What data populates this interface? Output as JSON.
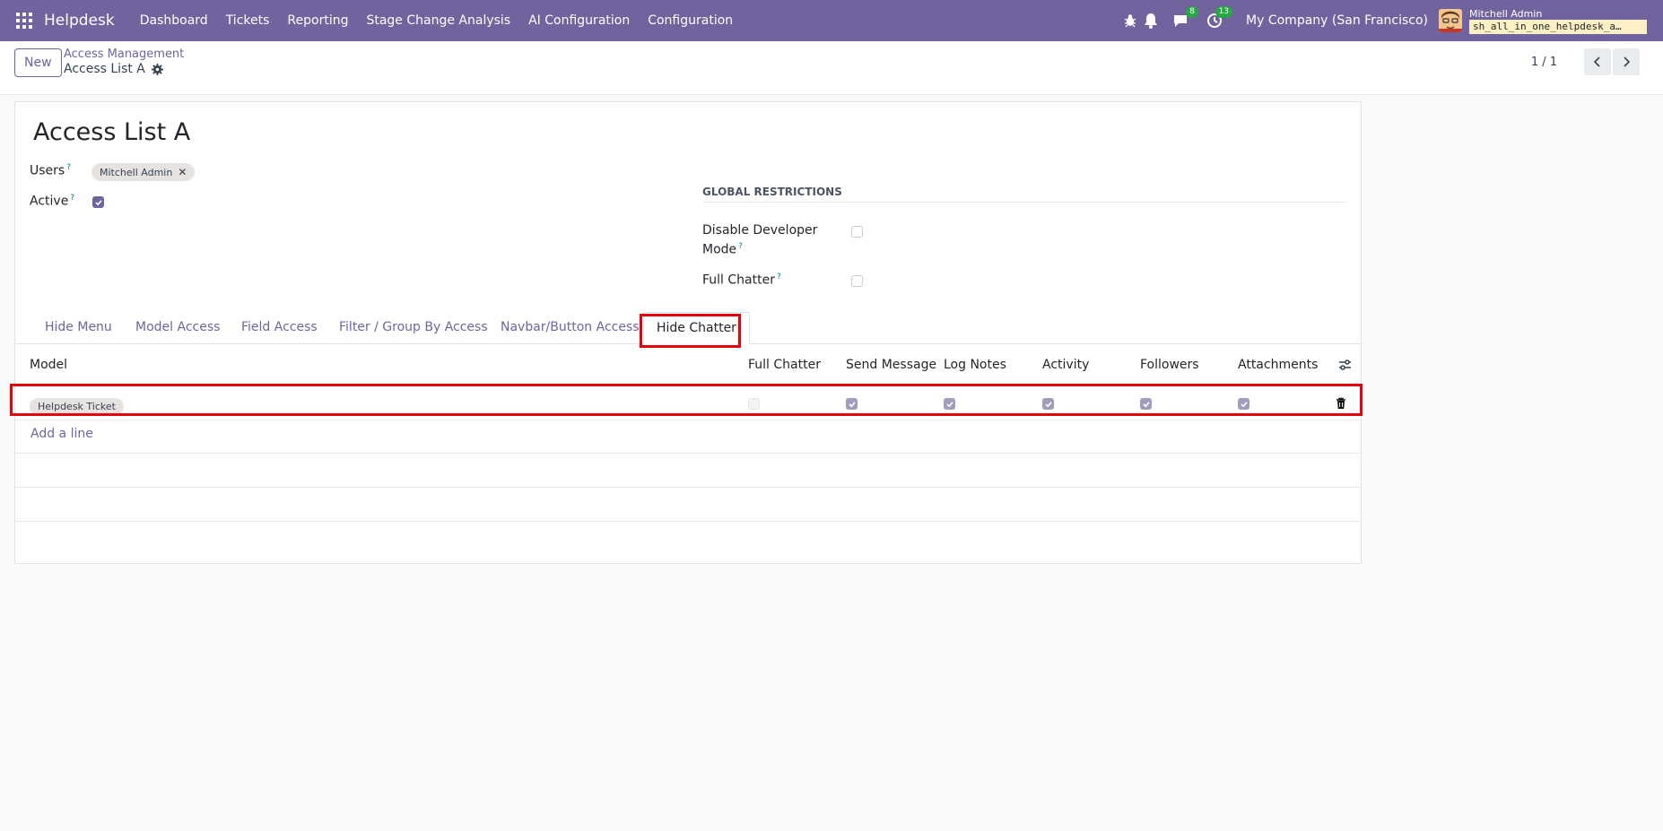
{
  "navbar": {
    "brand": "Helpdesk",
    "menu": [
      "Dashboard",
      "Tickets",
      "Reporting",
      "Stage Change Analysis",
      "AI Configuration",
      "Configuration"
    ],
    "messages_count": "8",
    "activities_count": "13",
    "company": "My Company (San Francisco)",
    "user_name": "Mitchell Admin",
    "database": "sh_all_in_one_helpdesk_a…"
  },
  "control": {
    "new_label": "New",
    "breadcrumb": "Access Management",
    "current": "Access List A",
    "pager": "1 / 1"
  },
  "form": {
    "title": "Access List A",
    "users_label": "Users",
    "user_tag": "Mitchell Admin",
    "active_label": "Active",
    "active": true,
    "global_title": "GLOBAL RESTRICTIONS",
    "disable_dev_label_1": "Disable Developer",
    "disable_dev_label_2": "Mode",
    "disable_dev": false,
    "full_chatter_label": "Full Chatter",
    "full_chatter": false
  },
  "tabs": [
    "Hide Menu",
    "Model Access",
    "Field Access",
    "Filter / Group By Access",
    "Navbar/Button Access",
    "Hide Chatter"
  ],
  "active_tab": "Hide Chatter",
  "table": {
    "headers": [
      "Model",
      "Full Chatter",
      "Send Message",
      "Log Notes",
      "Activity",
      "Followers",
      "Attachments"
    ],
    "rows": [
      {
        "model": "Helpdesk Ticket",
        "full_chatter": false,
        "send_message": true,
        "log_notes": true,
        "activity": true,
        "followers": true,
        "attachments": true
      }
    ],
    "add_line": "Add a line"
  },
  "colors": {
    "brand": "#71639e",
    "highlight": "#e8000b"
  }
}
